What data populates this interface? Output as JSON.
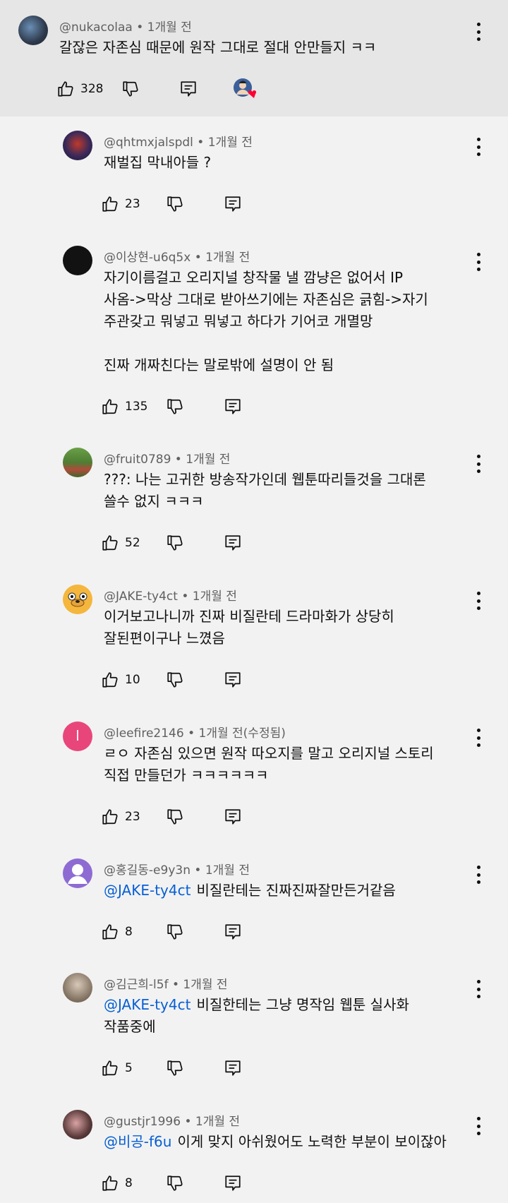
{
  "top_comment": {
    "author": "@nukacolaa",
    "time": "1개월 전",
    "text": [
      "갈잖은 자존심 때문에 원작 그대로 절대 안만들지 ㅋㅋ"
    ],
    "likes": "328"
  },
  "replies": [
    {
      "author": "@qhtmxjalspdl",
      "time": "1개월 전",
      "text": [
        "재벌집 막내아들 ?"
      ],
      "likes": "23"
    },
    {
      "author": "@이상현-u6q5x",
      "time": "1개월 전",
      "text": [
        "자기이름걸고 오리지널 창작물 낼 깜냥은 없어서 IP",
        "사옴->막상 그대로 받아쓰기에는 자존심은 긁힘->자기",
        "주관갖고 뭐넣고 뭐넣고 하다가 기어코 개멸망",
        "",
        "진짜 개짜친다는 말로밖에 설명이 안 됨"
      ],
      "likes": "135"
    },
    {
      "author": "@fruit0789",
      "time": "1개월 전",
      "text": [
        "???: 나는 고귀한 방송작가인데 웹툰따리들것을 그대론",
        "쓸수 없지 ㅋㅋㅋ"
      ],
      "likes": "52"
    },
    {
      "author": "@JAKE-ty4ct",
      "time": "1개월 전",
      "text": [
        "이거보고나니까 진짜 비질란테 드라마화가 상당히",
        "잘된편이구나 느꼈음"
      ],
      "likes": "10"
    },
    {
      "author": "@leefire2146",
      "time": "1개월 전(수정됨)",
      "text": [
        "ㄹㅇ 자존심 있으면 원작 따오지를 말고 오리지널 스토리",
        "직접 만들던가 ㅋㅋㅋㅋㅋㅋ"
      ],
      "likes": "23",
      "avatar_letter": "l"
    },
    {
      "author": "@홍길동-e9y3n",
      "time": "1개월 전",
      "mention": "@JAKE-ty4ct",
      "text": [
        "비질란테는 진짜진짜잘만든거같음"
      ],
      "likes": "8"
    },
    {
      "author": "@김근희-l5f",
      "time": "1개월 전",
      "mention": "@JAKE-ty4ct",
      "text": [
        "비질한테는 그냥 명작임 웹툰 실사화",
        "작품중에"
      ],
      "likes": "5"
    },
    {
      "author": "@gustjr1996",
      "time": "1개월 전",
      "mention": "@비공-f6u",
      "text": [
        "이게 맞지 아쉬웠어도 노력한 부분이 보이잖아"
      ],
      "likes": "8"
    }
  ],
  "colors": {
    "background": "#f2f2f2",
    "highlight": "#e6e6e6",
    "mention": "#065fd4",
    "heart": "#ff0033",
    "text": "#0f0f0f",
    "meta": "#606060"
  },
  "icons": [
    "thumbs-up-icon",
    "thumbs-down-icon",
    "reply-icon",
    "more-vert-icon",
    "creator-heart-icon"
  ]
}
